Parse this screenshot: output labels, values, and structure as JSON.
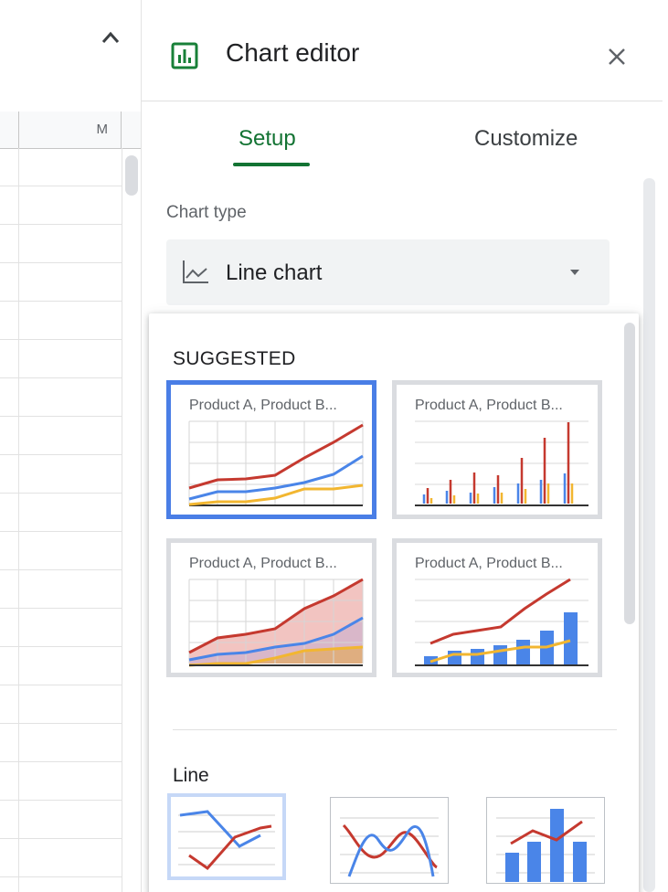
{
  "sheet": {
    "column_header": "M",
    "caret_icon": "chevron-up-icon"
  },
  "editor": {
    "title": "Chart editor",
    "close_icon": "close-icon",
    "chart_icon": "insert-chart-icon",
    "tabs": [
      {
        "label": "Setup",
        "active": true
      },
      {
        "label": "Customize",
        "active": false
      }
    ],
    "chart_type_label": "Chart type",
    "chart_type_value": "Line chart",
    "chart_type_icon": "line-chart-icon",
    "accent_color": "#137333"
  },
  "dropdown": {
    "suggested_heading": "SUGGESTED",
    "suggested": [
      {
        "label": "Product A, Product B...",
        "kind": "line",
        "selected": true
      },
      {
        "label": "Product A, Product B...",
        "kind": "column",
        "selected": false
      },
      {
        "label": "Product A, Product B...",
        "kind": "area",
        "selected": false
      },
      {
        "label": "Product A, Product B...",
        "kind": "combo",
        "selected": false
      }
    ],
    "line_heading": "Line",
    "line_options": [
      {
        "kind": "line",
        "selected": true
      },
      {
        "kind": "smooth-line",
        "selected": false
      },
      {
        "kind": "combo",
        "selected": false
      }
    ],
    "series_colors": {
      "product_a": "#c5392f",
      "product_b": "#4a85e8",
      "product_c": "#f2b630"
    }
  }
}
